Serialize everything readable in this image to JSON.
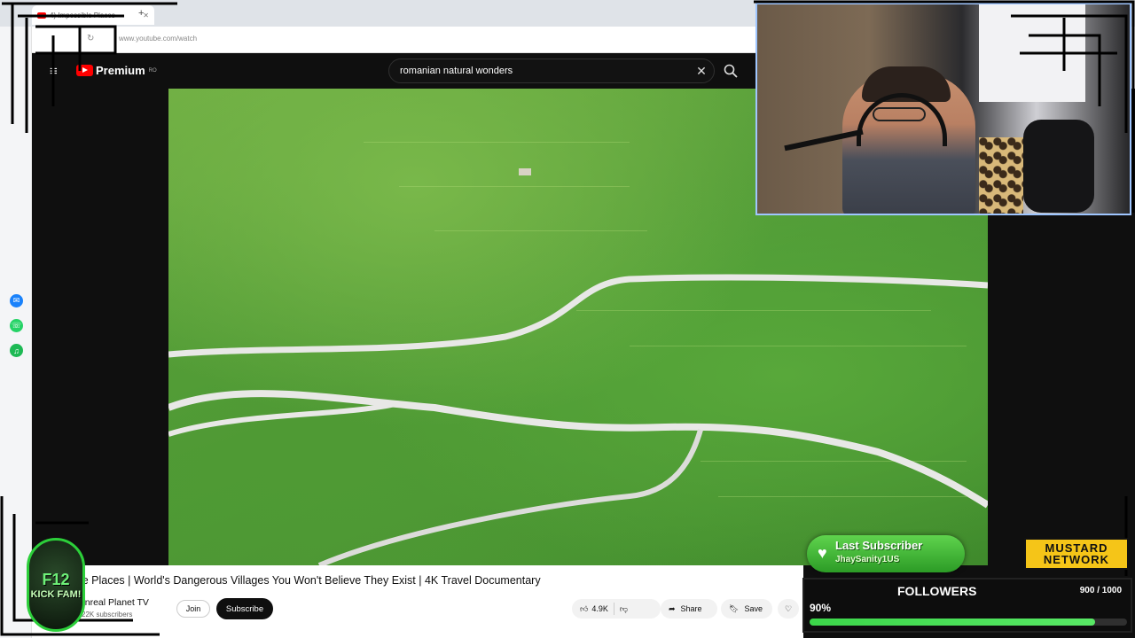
{
  "browser": {
    "tab_title": "4) Impossible Places",
    "new_tab": "+",
    "url": "www.youtube.com/watch"
  },
  "youtube": {
    "logo_text": "Premium",
    "logo_region": "RO",
    "search_query": "romanian natural wonders",
    "video_title": "ble Places | World's Dangerous Villages You Won't Believe They Exist | 4K Travel Documentary",
    "channel_name": "y Unreal Planet TV",
    "subscribers": "22K subscribers",
    "join_label": "Join",
    "subscribe_label": "Subscribe",
    "likes": "4.9K",
    "share_label": "Share",
    "save_label": "Save"
  },
  "overlay": {
    "last_subscriber_label": "Last Subscriber",
    "last_subscriber_name": "JhaySanity1US",
    "network_line1": "MUSTARD",
    "network_line2": "NETWORK",
    "followers_label": "FOLLOWERS",
    "followers_count": "900 / 1000",
    "followers_percent_text": "90%",
    "followers_progress": 0.9,
    "badge_line1": "F12",
    "badge_line2": "KICK FAM!"
  },
  "colors": {
    "youtube_red": "#ff0000",
    "overlay_green": "#3cd64a",
    "network_yellow": "#f5c518"
  }
}
